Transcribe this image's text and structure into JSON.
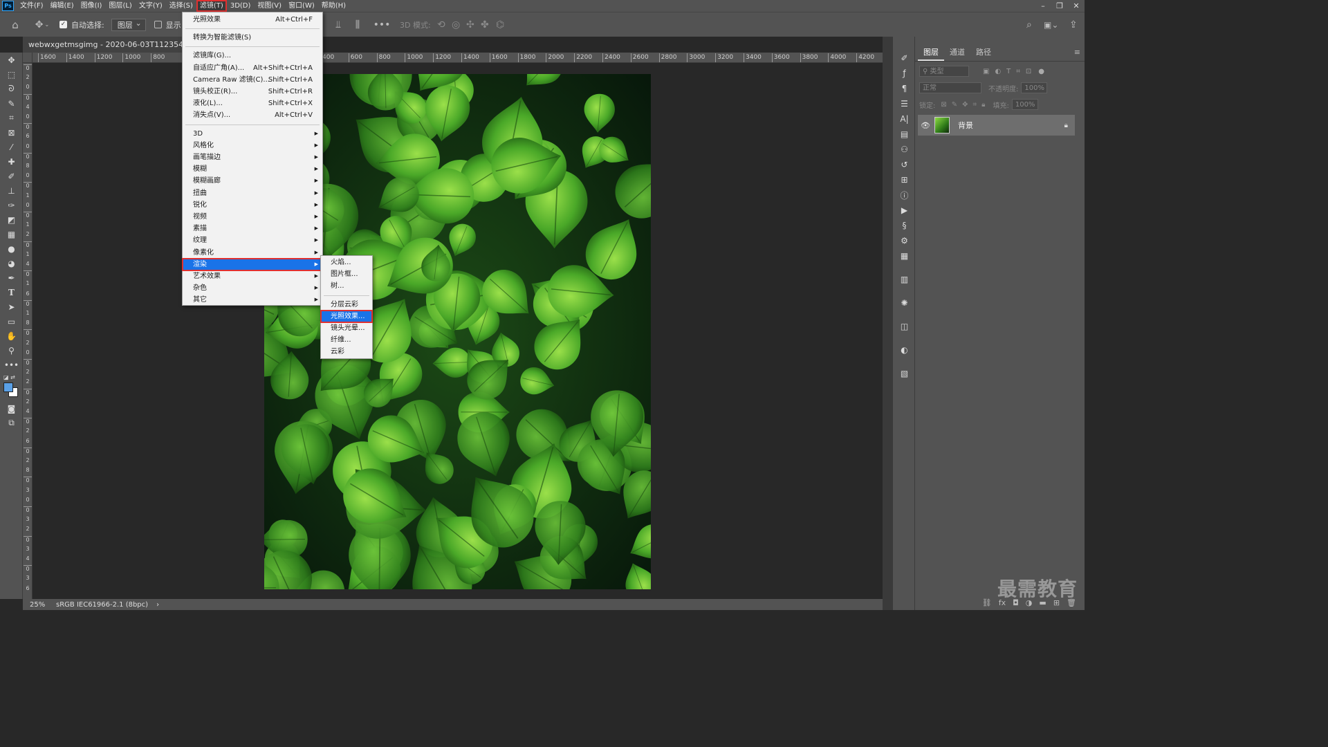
{
  "menubar": {
    "logo": "Ps",
    "items": [
      "文件(F)",
      "编辑(E)",
      "图像(I)",
      "图层(L)",
      "文字(Y)",
      "选择(S)",
      "滤镜(T)",
      "3D(D)",
      "视图(V)",
      "窗口(W)",
      "帮助(H)"
    ],
    "active_index": 6
  },
  "options": {
    "auto_select_label": "自动选择:",
    "auto_select_value": "图层",
    "show_label": "显示",
    "mode_3d_label": "3D 模式:"
  },
  "document": {
    "tab_title": "webwxgetmsgimg - 2020-06-03T112354.785.jpg"
  },
  "ruler": {
    "h_ticks": [
      "1600",
      "1400",
      "1200",
      "1000",
      "800",
      "",
      "",
      "",
      "",
      "",
      "400",
      "600",
      "800",
      "1000",
      "1200",
      "1400",
      "1600",
      "1800",
      "2000",
      "2200",
      "2400",
      "2600",
      "2800",
      "3000",
      "3200",
      "3400",
      "3600",
      "3800",
      "4000",
      "4200"
    ],
    "v_ticks": [
      "0",
      "2",
      "0",
      "0",
      "4",
      "0",
      "0",
      "6",
      "0",
      "0",
      "8",
      "0",
      "0",
      "1",
      "0",
      "0",
      "1",
      "2",
      "0",
      "1",
      "4",
      "0",
      "1",
      "6",
      "0",
      "1",
      "8",
      "0",
      "2",
      "0",
      "0",
      "2",
      "2",
      "0",
      "2",
      "4",
      "0",
      "2",
      "6",
      "0",
      "2",
      "8",
      "0",
      "3",
      "0",
      "0",
      "3",
      "2",
      "0",
      "3",
      "4",
      "0",
      "3",
      "6"
    ]
  },
  "status": {
    "zoom": "25%",
    "profile": "sRGB IEC61966-2.1 (8bpc)",
    "arrow": "›"
  },
  "filter_menu": {
    "items": [
      {
        "label": "光照效果",
        "shortcut": "Alt+Ctrl+F",
        "submenu": false
      },
      {
        "sep": true
      },
      {
        "label": "转换为智能滤镜(S)",
        "shortcut": "",
        "submenu": false
      },
      {
        "sep": true
      },
      {
        "label": "滤镜库(G)...",
        "shortcut": "",
        "submenu": false
      },
      {
        "label": "自适应广角(A)...",
        "shortcut": "Alt+Shift+Ctrl+A",
        "submenu": false
      },
      {
        "label": "Camera Raw 滤镜(C)...",
        "shortcut": "Shift+Ctrl+A",
        "submenu": false
      },
      {
        "label": "镜头校正(R)...",
        "shortcut": "Shift+Ctrl+R",
        "submenu": false
      },
      {
        "label": "液化(L)...",
        "shortcut": "Shift+Ctrl+X",
        "submenu": false
      },
      {
        "label": "消失点(V)...",
        "shortcut": "Alt+Ctrl+V",
        "submenu": false
      },
      {
        "sep": true
      },
      {
        "label": "3D",
        "shortcut": "",
        "submenu": true
      },
      {
        "label": "风格化",
        "shortcut": "",
        "submenu": true
      },
      {
        "label": "画笔描边",
        "shortcut": "",
        "submenu": true
      },
      {
        "label": "模糊",
        "shortcut": "",
        "submenu": true
      },
      {
        "label": "模糊画廊",
        "shortcut": "",
        "submenu": true
      },
      {
        "label": "扭曲",
        "shortcut": "",
        "submenu": true
      },
      {
        "label": "锐化",
        "shortcut": "",
        "submenu": true
      },
      {
        "label": "视频",
        "shortcut": "",
        "submenu": true
      },
      {
        "label": "素描",
        "shortcut": "",
        "submenu": true
      },
      {
        "label": "纹理",
        "shortcut": "",
        "submenu": true
      },
      {
        "label": "像素化",
        "shortcut": "",
        "submenu": true
      },
      {
        "label": "渲染",
        "shortcut": "",
        "submenu": true,
        "highlighted": true
      },
      {
        "label": "艺术效果",
        "shortcut": "",
        "submenu": true
      },
      {
        "label": "杂色",
        "shortcut": "",
        "submenu": true
      },
      {
        "label": "其它",
        "shortcut": "",
        "submenu": true
      }
    ]
  },
  "render_submenu": {
    "items": [
      {
        "label": "火焰..."
      },
      {
        "label": "图片框..."
      },
      {
        "label": "树..."
      },
      {
        "sep": true
      },
      {
        "label": "分层云彩"
      },
      {
        "label": "光照效果...",
        "highlighted": true
      },
      {
        "label": "镜头光晕..."
      },
      {
        "label": "纤维..."
      },
      {
        "label": "云彩"
      }
    ]
  },
  "layers_panel": {
    "tabs": [
      "图层",
      "通道",
      "路径"
    ],
    "active_tab": 0,
    "kind_placeholder": "类型",
    "blend_mode": "正常",
    "opacity_label": "不透明度:",
    "opacity_value": "100%",
    "lock_label": "锁定:",
    "fill_label": "填充:",
    "fill_value": "100%",
    "layers": [
      {
        "name": "背景",
        "visible": true,
        "locked": true
      }
    ]
  },
  "watermark": "最需教育",
  "colors": {
    "accent": "#1a73e8",
    "highlight_border": "#e03030",
    "foreground_swatch": "#5aa0e6",
    "background_swatch": "#ffffff"
  }
}
